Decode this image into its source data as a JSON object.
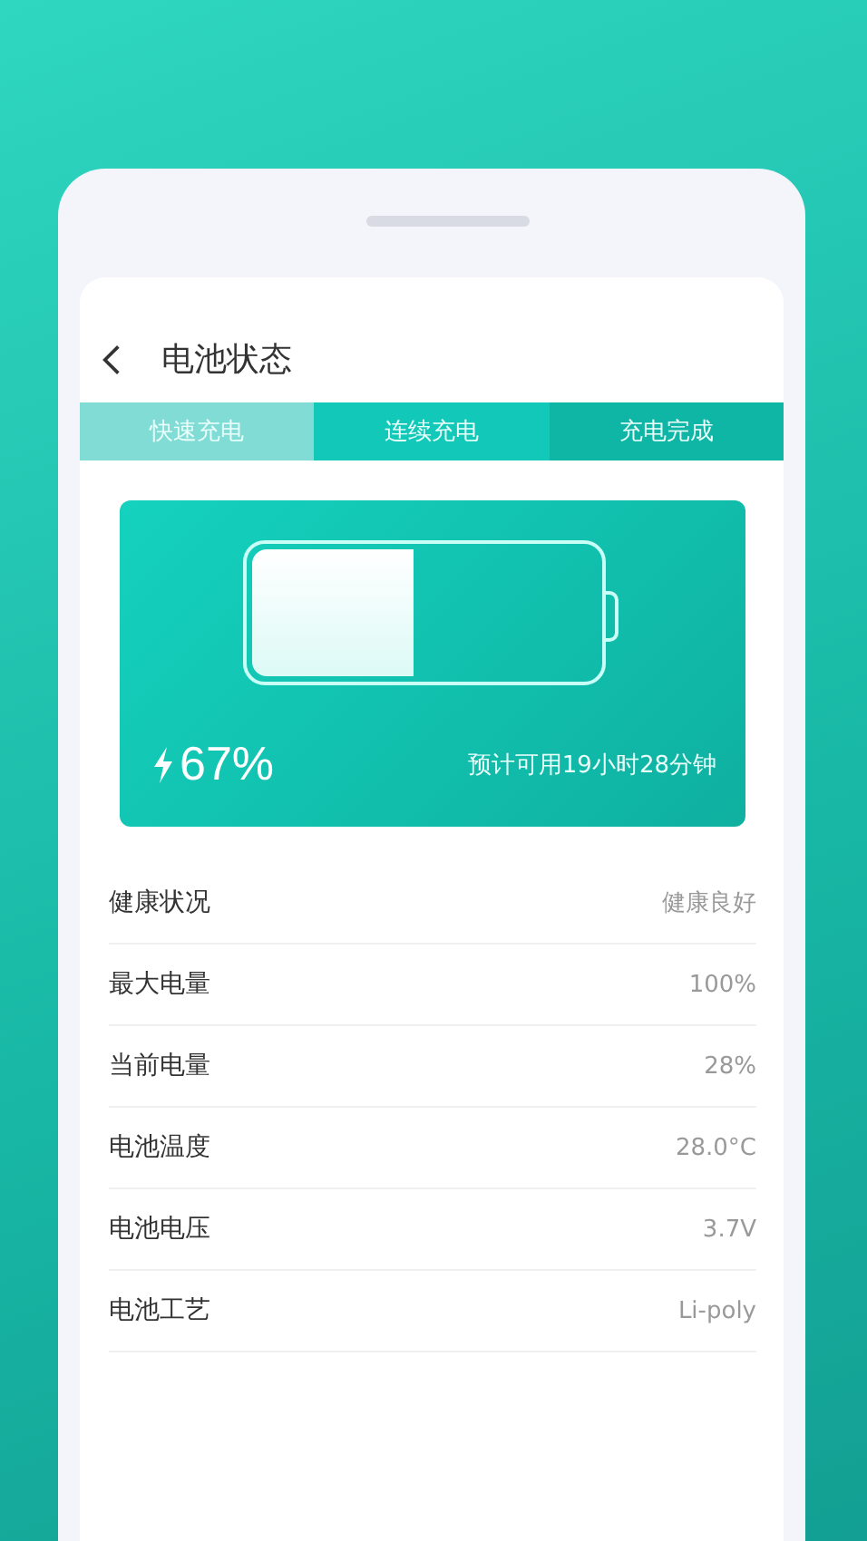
{
  "header": {
    "title": "电池状态"
  },
  "tabs": [
    {
      "label": "快速充电",
      "color": "#82dcd6"
    },
    {
      "label": "连续充电",
      "color": "#12c9b9"
    },
    {
      "label": "充电完成",
      "color": "#0fb5a5"
    }
  ],
  "battery_card": {
    "level": 0.47,
    "percent": "67%",
    "estimate": "预计可用19小时28分钟"
  },
  "rows": [
    {
      "label": "健康状况",
      "value": "健康良好"
    },
    {
      "label": "最大电量",
      "value": "100%"
    },
    {
      "label": "当前电量",
      "value": "28%"
    },
    {
      "label": "电池温度",
      "value": "28.0°C"
    },
    {
      "label": "电池电压",
      "value": "3.7V"
    },
    {
      "label": "电池工艺",
      "value": "Li-poly"
    }
  ]
}
